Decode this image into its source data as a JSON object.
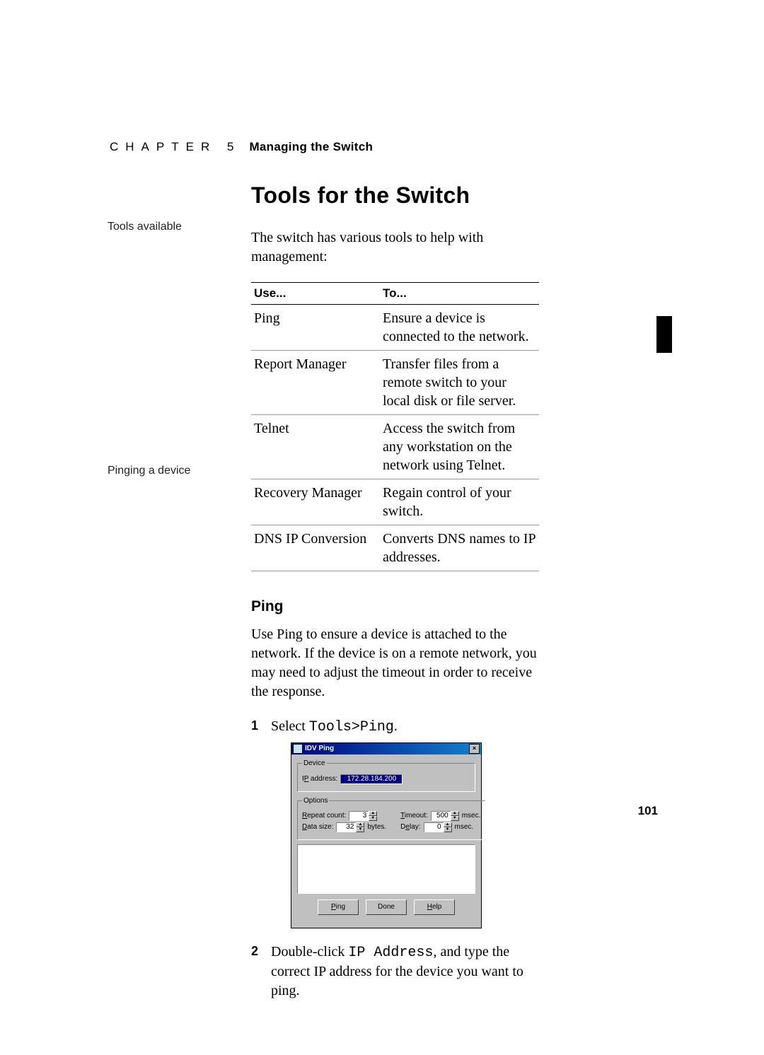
{
  "header": {
    "chapter_word": "CHAPTER",
    "chapter_num": "5",
    "chapter_title": "Managing the Switch"
  },
  "title": "Tools for the Switch",
  "side": {
    "tools_available": "Tools available",
    "pinging": "Pinging a device"
  },
  "intro": "The switch has various tools to help with management:",
  "table": {
    "head_use": "Use...",
    "head_to": "To...",
    "rows": [
      {
        "use": "Ping",
        "to": "Ensure a device is connected to the net­work."
      },
      {
        "use": "Report Manager",
        "to": "Transfer files from a remote switch to your local disk or file server."
      },
      {
        "use": "Telnet",
        "to": "Access the switch from any workstation on the network using Telnet."
      },
      {
        "use": "Recovery Manager",
        "to": "Regain control of your switch."
      },
      {
        "use": "DNS IP Conversion",
        "to": "Converts DNS names to IP addresses."
      }
    ]
  },
  "ping": {
    "heading": "Ping",
    "intro": "Use Ping to ensure a device is attached to the network. If the device is on a remote network, you may need to adjust the timeout in order to receive the response.",
    "step1_prefix": "Select ",
    "step1_mono": "Tools>Ping",
    "step1_suffix": ".",
    "step2_prefix": "Double-click ",
    "step2_mono": "IP Address",
    "step2_suffix": ", and type the correct IP address for the device you want to ping."
  },
  "dialog": {
    "title": "IDV Ping",
    "grp_device": "Device",
    "lbl_ip": "IP address:",
    "ip_value": "172.28.184.200",
    "grp_options": "Options",
    "lbl_repeat": "Repeat count:",
    "val_repeat": "3",
    "lbl_timeout": "Timeout:",
    "val_timeout": "500",
    "unit_timeout": "msec.",
    "lbl_datasize": "Data size:",
    "val_datasize": "32",
    "unit_datasize": "bytes.",
    "lbl_delay": "Delay:",
    "val_delay": "0",
    "unit_delay": "msec.",
    "btn_ping": "Ping",
    "btn_done": "Done",
    "btn_help": "Help"
  },
  "page_number": "101"
}
